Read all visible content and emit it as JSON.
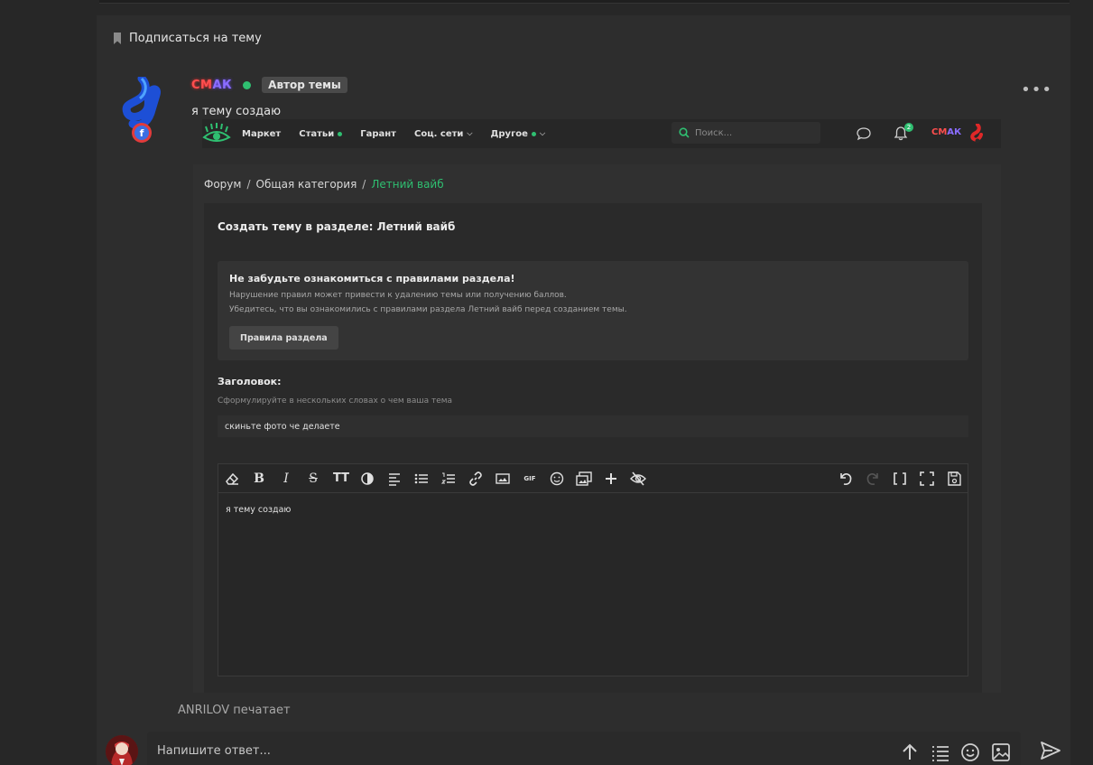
{
  "subscribe": {
    "label": "Подписаться на тему"
  },
  "post": {
    "author_nick_part1": "СМ",
    "author_nick_part2": "АК",
    "author_badge": "Автор темы",
    "text": "я тему создаю",
    "more": "•••"
  },
  "embedded": {
    "nav": {
      "items": [
        {
          "label": "Маркет"
        },
        {
          "label": "Статьи"
        },
        {
          "label": "Гарант"
        },
        {
          "label": "Соц. сети"
        },
        {
          "label": "Другое"
        }
      ],
      "search_placeholder": "Поиск...",
      "notif_count": "2",
      "user_nick_part1": "СМ",
      "user_nick_part2": "АК"
    },
    "breadcrumbs": {
      "forum": "Форум",
      "category": "Общая категория",
      "current": "Летний вайб",
      "sep": "/"
    },
    "form": {
      "title": "Создать тему в разделе: Летний вайб",
      "notice": {
        "title": "Не забудьте ознакомиться с правилами раздела!",
        "line1": "Нарушение правил может привести к удалению темы или получению баллов.",
        "line2": "Убедитесь, что вы ознакомились с правилами раздела Летний вайб перед созданием темы.",
        "button": "Правила раздела"
      },
      "title_label": "Заголовок:",
      "title_hint": "Сформулируйте в нескольких словах о чем ваша тема",
      "title_value": "скиньте фото че делаете",
      "editor": {
        "bold": "B",
        "italic": "I",
        "strike": "S",
        "text_size": "TT",
        "gif": "GIF",
        "content": "я тему создаю"
      }
    }
  },
  "typing": {
    "text": "ANRILOV печатает"
  },
  "reply": {
    "placeholder": "Напишите ответ..."
  },
  "colors": {
    "accent": "#2fbf71",
    "background": "#272727",
    "card": "#2d2d2d"
  }
}
